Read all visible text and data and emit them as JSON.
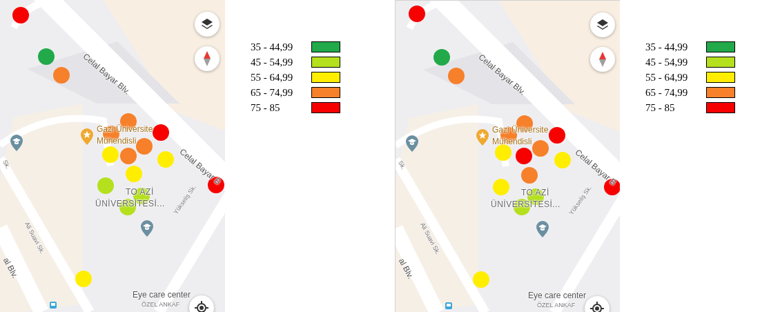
{
  "panels": [
    {
      "map": {
        "labels": [
          "Celal Bayar Blv.",
          "Celal Bayar B",
          "Gazi Üniversite",
          "Mühendisli",
          "TO AZİ",
          "ÜNİVERSİTESİ...",
          "Ali Suavi Sk.",
          "Yükseliş Sk.",
          "Sk.",
          "al Blv.",
          "Eye care center",
          "ÖZEL ANKAF"
        ],
        "dots": [
          {
            "color": "#f60000"
          },
          {
            "color": "#22a94a"
          },
          {
            "color": "#f7802a"
          },
          {
            "color": "#f7802a"
          },
          {
            "color": "#f7802a"
          },
          {
            "color": "#f60000"
          },
          {
            "color": "#f7802a"
          },
          {
            "color": "#ffee00"
          },
          {
            "color": "#f7802a"
          },
          {
            "color": "#ffee00"
          },
          {
            "color": "#ffee00"
          },
          {
            "color": "#b5e01e"
          },
          {
            "color": "#b5e01e"
          },
          {
            "color": "#b5e01e"
          },
          {
            "color": "#f60000"
          },
          {
            "color": "#ffee00"
          }
        ]
      },
      "legend": [
        {
          "label": "35 - 44,99",
          "color": "#22a94a"
        },
        {
          "label": "45 - 54,99",
          "color": "#b5e01e"
        },
        {
          "label": "55 - 64,99",
          "color": "#ffee00"
        },
        {
          "label": "65 - 74,99",
          "color": "#f7802a"
        },
        {
          "label": "75 - 85",
          "color": "#f60000"
        }
      ]
    },
    {
      "map": {
        "labels": [
          "Celal Bayar Blv.",
          "Celal Bayar B",
          "Gazi Üniversite",
          "Mühendisli",
          "TO AZİ",
          "ÜNİVERSİTESİ...",
          "Ali Suavi Sk.",
          "Yükseliş Sk.",
          "Sk.",
          "al Blv.",
          "Eye care center",
          "ÖZEL ANKAF"
        ],
        "dots": [
          {
            "color": "#f60000"
          },
          {
            "color": "#22a94a"
          },
          {
            "color": "#f7802a"
          },
          {
            "color": "#f7802a"
          },
          {
            "color": "#f7802a"
          },
          {
            "color": "#f60000"
          },
          {
            "color": "#f7802a"
          },
          {
            "color": "#ffee00"
          },
          {
            "color": "#f60000"
          },
          {
            "color": "#ffee00"
          },
          {
            "color": "#f7802a"
          },
          {
            "color": "#ffee00"
          },
          {
            "color": "#b5e01e"
          },
          {
            "color": "#b5e01e"
          },
          {
            "color": "#f60000"
          },
          {
            "color": "#ffee00"
          }
        ]
      },
      "legend": [
        {
          "label": "35 - 44,99",
          "color": "#22a94a"
        },
        {
          "label": "45 - 54,99",
          "color": "#b5e01e"
        },
        {
          "label": "55 - 64,99",
          "color": "#ffee00"
        },
        {
          "label": "65 - 74,99",
          "color": "#f7802a"
        },
        {
          "label": "75 - 85",
          "color": "#f60000"
        }
      ]
    }
  ]
}
